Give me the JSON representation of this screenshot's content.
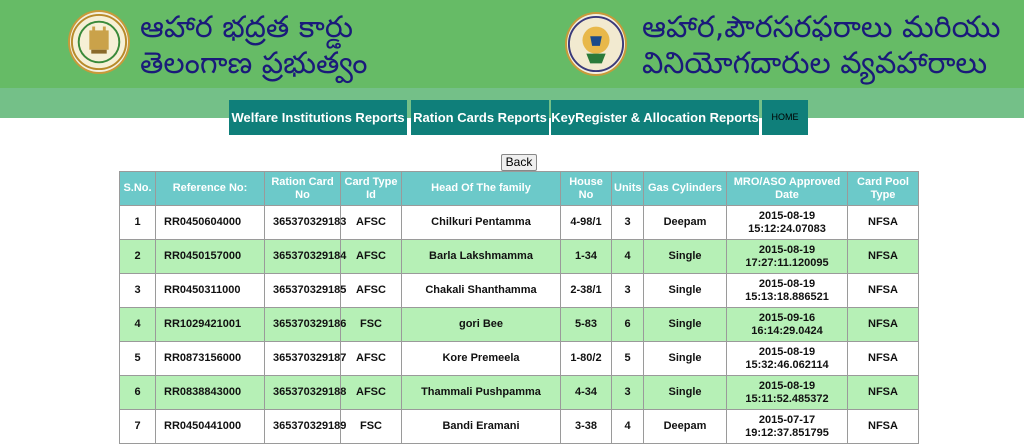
{
  "header": {
    "left_title_line1": "ఆహార భద్రత కార్డు",
    "left_title_line2": "తెలంగాణ ప్రభుత్వం",
    "right_title_line1": "ఆహార,పౌరసరఫరాలు మరియు",
    "right_title_line2": "వినియోగదారుల వ్యవహారాలు",
    "colors": {
      "banner": "#66bb66",
      "title_text": "#1a1a7a"
    }
  },
  "nav": {
    "items": [
      {
        "label": "Welfare Institutions Reports"
      },
      {
        "label": "Ration Cards Reports"
      },
      {
        "label": "KeyRegister & Allocation Reports"
      },
      {
        "label": "HOME"
      }
    ],
    "colors": {
      "button_bg": "#0f7f7a"
    }
  },
  "back_label": "Back",
  "table": {
    "headers": [
      "S.No.",
      "Reference No:",
      "Ration Card No",
      "Card Type Id",
      "Head Of The family",
      "House No",
      "Units",
      "Gas Cylinders",
      "MRO/ASO Approved Date",
      "Card Pool Type"
    ],
    "rows": [
      {
        "sno": "1",
        "ref": "RR0450604000",
        "card": "365370329183",
        "type": "AFSC",
        "head": "Chilkuri Pentamma",
        "house": "4-98/1",
        "units": "3",
        "gas": "Deepam",
        "date": "2015-08-19",
        "time": "15:12:24.07083",
        "pool": "NFSA"
      },
      {
        "sno": "2",
        "ref": "RR0450157000",
        "card": "365370329184",
        "type": "AFSC",
        "head": "Barla Lakshmamma",
        "house": "1-34",
        "units": "4",
        "gas": "Single",
        "date": "2015-08-19",
        "time": "17:27:11.120095",
        "pool": "NFSA"
      },
      {
        "sno": "3",
        "ref": "RR0450311000",
        "card": "365370329185",
        "type": "AFSC",
        "head": "Chakali Shanthamma",
        "house": "2-38/1",
        "units": "3",
        "gas": "Single",
        "date": "2015-08-19",
        "time": "15:13:18.886521",
        "pool": "NFSA"
      },
      {
        "sno": "4",
        "ref": "RR1029421001",
        "card": "365370329186",
        "type": "FSC",
        "head": "gori Bee",
        "house": "5-83",
        "units": "6",
        "gas": "Single",
        "date": "2015-09-16",
        "time": "16:14:29.0424",
        "pool": "NFSA"
      },
      {
        "sno": "5",
        "ref": "RR0873156000",
        "card": "365370329187",
        "type": "AFSC",
        "head": "Kore Premeela",
        "house": "1-80/2",
        "units": "5",
        "gas": "Single",
        "date": "2015-08-19",
        "time": "15:32:46.062114",
        "pool": "NFSA"
      },
      {
        "sno": "6",
        "ref": "RR0838843000",
        "card": "365370329188",
        "type": "AFSC",
        "head": "Thammali Pushpamma",
        "house": "4-34",
        "units": "3",
        "gas": "Single",
        "date": "2015-08-19",
        "time": "15:11:52.485372",
        "pool": "NFSA"
      },
      {
        "sno": "7",
        "ref": "RR0450441000",
        "card": "365370329189",
        "type": "FSC",
        "head": "Bandi Eramani",
        "house": "3-38",
        "units": "4",
        "gas": "Deepam",
        "date": "2015-07-17",
        "time": "19:12:37.851795",
        "pool": "NFSA"
      }
    ],
    "colors": {
      "header_bg": "#6cc9c9",
      "even_row": "#b6f0b6",
      "odd_row": "#ffffff"
    }
  },
  "icons": {
    "left_emblem": "telangana-emblem-icon",
    "right_emblem": "department-logo-icon"
  }
}
